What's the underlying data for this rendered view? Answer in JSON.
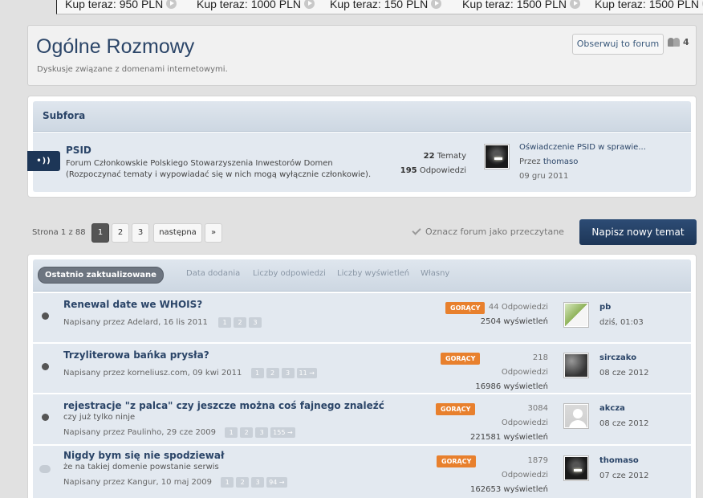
{
  "ticker": [
    {
      "label": "Kup teraz: 950 PLN"
    },
    {
      "label": "Kup teraz: 1000 PLN"
    },
    {
      "label": "Kup teraz: 150 PLN"
    },
    {
      "label": "Kup teraz: 1500 PLN"
    },
    {
      "label": "Kup teraz: 1500 PLN"
    }
  ],
  "header": {
    "title": "Ogólne Rozmowy",
    "description": "Dyskusje związane z domenami internetowymi.",
    "watch_label": "Obserwuj to forum",
    "watchers_count": "4"
  },
  "subforums": {
    "heading": "Subfora",
    "items": [
      {
        "badge": "•))",
        "title": "PSID",
        "description_line1": "Forum Członkowskie Polskiego Stowarzyszenia Inwestorów Domen",
        "description_line2": "(Rozpoczynać tematy i wypowiadać się w nich mogą wyłącznie członkowie).",
        "topics_count": "22",
        "topics_label": "Tematy",
        "replies_count": "195",
        "replies_label": "Odpowiedzi",
        "last_post_title": "Oświadczenie PSID w sprawie...",
        "last_post_by_prefix": "Przez",
        "last_post_user": "thomaso",
        "last_post_date": "09 gru 2011"
      }
    ]
  },
  "pagination": {
    "label": "Strona 1 z 88",
    "pages": [
      "1",
      "2",
      "3"
    ],
    "next_label": "następna",
    "last_label": "»"
  },
  "actions": {
    "mark_read": "Oznacz forum jako przeczytane",
    "new_topic": "Napisz nowy temat"
  },
  "sort_tabs": [
    "Ostatnio zaktualizowane",
    "Data dodania",
    "Liczby odpowiedzi",
    "Liczby wyświetleń",
    "Własny"
  ],
  "threads": [
    {
      "title": "Renewal date we WHOIS?",
      "subtitle": "",
      "meta": "Napisany przez Adelard, 16 lis 2011",
      "pages": [
        "1",
        "2",
        "3"
      ],
      "badge": "GORĄCY",
      "replies": "44 Odpowiedzi",
      "views": "2504 wyświetleń",
      "last_user": "pb",
      "last_date": "dziś, 01:03",
      "avatar": "green"
    },
    {
      "title": "Trzyliterowa bańka prysła?",
      "subtitle": "",
      "meta": "Napisany przez korneliusz.com, 09 kwi 2011",
      "pages": [
        "1",
        "2",
        "3",
        "11 →"
      ],
      "badge": "GORĄCY",
      "replies": "218 Odpowiedzi",
      "views": "16986 wyświetleń",
      "last_user": "sirczako",
      "last_date": "08 cze 2012",
      "avatar": "stone"
    },
    {
      "title": "rejestracje \"z palca\" czy jeszcze można coś fajnego znaleźć",
      "subtitle": "czy już tylko ninje",
      "meta": "Napisany przez Paulinho, 29 cze 2009",
      "pages": [
        "1",
        "2",
        "3",
        "155 →"
      ],
      "badge": "GORĄCY",
      "replies": "3084 Odpowiedzi",
      "views": "221581 wyświetleń",
      "last_user": "akcza",
      "last_date": "08 cze 2012",
      "avatar": "gray"
    },
    {
      "title": "Nigdy bym się nie spodziewał",
      "subtitle": "że na takiej domenie powstanie serwis",
      "meta": "Napisany przez Kangur, 10 maj 2009",
      "pages": [
        "1",
        "2",
        "3",
        "94 →"
      ],
      "badge": "GORĄCY",
      "replies": "1879 Odpowiedzi",
      "views": "162653 wyświetleń",
      "last_user": "thomaso",
      "last_date": "07 cze 2012",
      "avatar": "dark"
    }
  ]
}
